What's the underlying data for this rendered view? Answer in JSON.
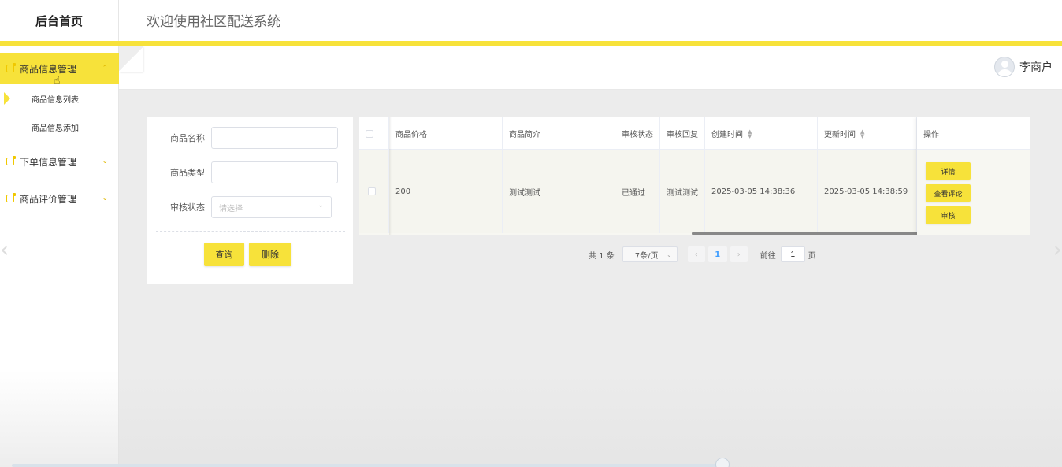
{
  "sidebar": {
    "brand": "后台首页",
    "menus": [
      {
        "label": "商品信息管理",
        "expanded": true,
        "chevron": "chevron-up-icon"
      },
      {
        "label": "下单信息管理",
        "expanded": false,
        "chevron": "chevron-down-icon"
      },
      {
        "label": "商品评价管理",
        "expanded": false,
        "chevron": "chevron-down-icon"
      }
    ],
    "submenus": [
      {
        "label": "商品信息列表",
        "current": true
      },
      {
        "label": "商品信息添加",
        "current": false
      }
    ]
  },
  "topbar": {
    "title": "欢迎使用社区配送系统"
  },
  "user": {
    "name": "李商户"
  },
  "search": {
    "name_label": "商品名称",
    "name_value": "",
    "type_label": "商品类型",
    "type_value": "",
    "status_label": "审核状态",
    "status_placeholder": "请选择",
    "query_button": "查询",
    "delete_button": "删除"
  },
  "table": {
    "columns": [
      "商品价格",
      "商品简介",
      "审核状态",
      "审核回复",
      "创建时间",
      "更新时间"
    ],
    "operation_header": "操作",
    "rows": [
      {
        "price": "200",
        "intro": "测试测试",
        "status": "已通过",
        "reply": "测试测试",
        "created": "2025-03-05 14:38:36",
        "updated": "2025-03-05 14:38:59"
      }
    ],
    "row_actions": [
      "详情",
      "查看评论",
      "审核"
    ]
  },
  "pagination": {
    "total": "共 1 条",
    "page_size": "7条/页",
    "current_page": "1",
    "goto_label": "前往",
    "goto_value": "1",
    "page_suffix": "页"
  },
  "colors": {
    "accent": "#f7e23a",
    "sidebar_icon": "#f0c800",
    "page_active": "#409eff"
  }
}
